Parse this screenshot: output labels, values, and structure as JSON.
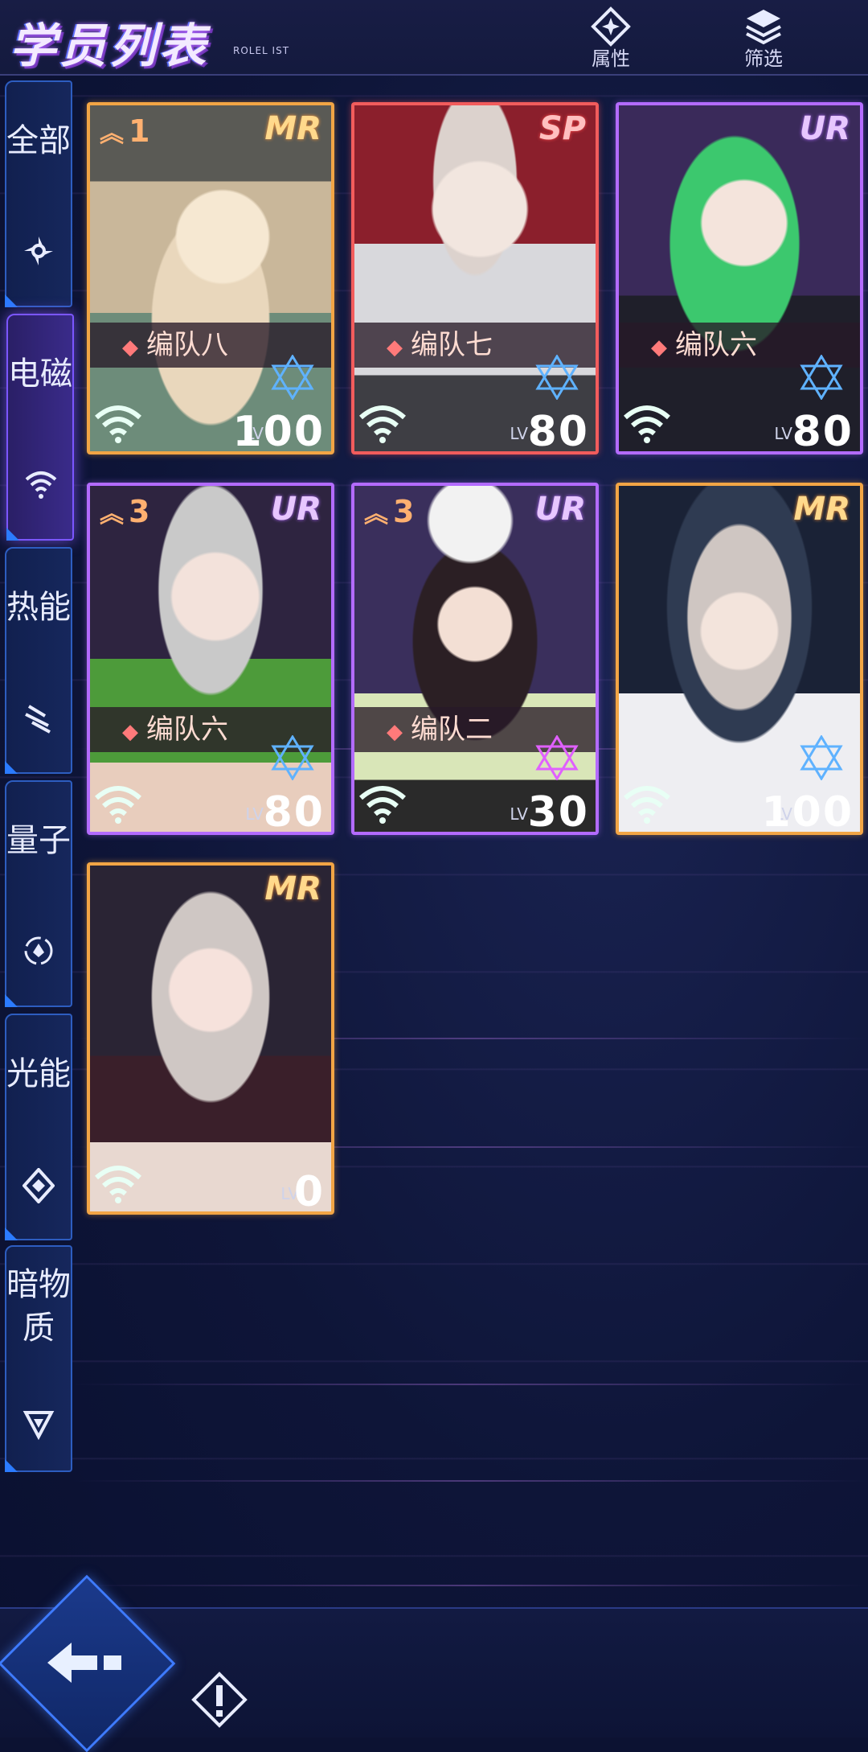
{
  "header": {
    "title": "学员列表",
    "subtitle": "ROLEL IST",
    "attr_label": "属性",
    "filter_label": "筛选"
  },
  "tabs": [
    {
      "label": "全部",
      "icon": "shuriken-icon",
      "active": false
    },
    {
      "label": "电磁",
      "icon": "wifi-icon",
      "active": true
    },
    {
      "label": "热能",
      "icon": "slash-lines-icon",
      "active": false
    },
    {
      "label": "量子",
      "icon": "quantum-circle-icon",
      "active": false
    },
    {
      "label": "光能",
      "icon": "diamond-icon",
      "active": false
    },
    {
      "label": "暗物质",
      "icon": "triangle-down-icon",
      "active": false
    }
  ],
  "cards": [
    {
      "rarity": "MR",
      "rank": "1",
      "team": "编队八",
      "level": "100",
      "lv_label": "LV",
      "frame": "mr"
    },
    {
      "rarity": "SP",
      "rank": "",
      "team": "编队七",
      "level": "80",
      "lv_label": "LV",
      "frame": "sp"
    },
    {
      "rarity": "UR",
      "rank": "",
      "team": "编队六",
      "level": "80",
      "lv_label": "LV",
      "frame": "ur"
    },
    {
      "rarity": "UR",
      "rank": "3",
      "team": "编队六",
      "level": "80",
      "lv_label": "LV",
      "frame": "ur"
    },
    {
      "rarity": "UR",
      "rank": "3",
      "team": "编队二",
      "level": "30",
      "lv_label": "LV",
      "frame": "ur"
    },
    {
      "rarity": "MR",
      "rank": "",
      "team": "",
      "level": "100",
      "lv_label": "LV",
      "frame": "mr"
    },
    {
      "rarity": "MR",
      "rank": "",
      "team": "",
      "level": "0",
      "lv_label": "LV",
      "frame": "mr"
    }
  ],
  "colors": {
    "background": "#0c1232",
    "mr_frame": "#f2a545",
    "ur_frame": "#b36bff",
    "sp_frame": "#f25c5c",
    "tab_border": "#2d5dc0",
    "active_tab": "#7b56ff"
  },
  "bottom": {
    "back_icon": "back-arrow-icon",
    "help_icon": "exclamation-icon"
  }
}
